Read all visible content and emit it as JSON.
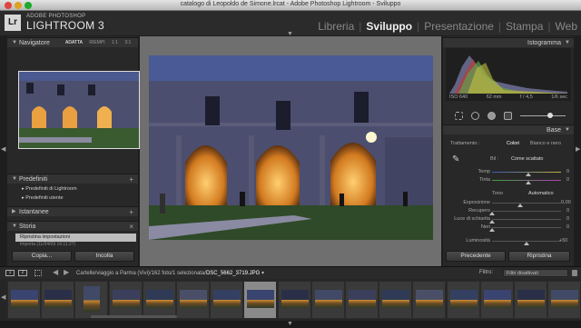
{
  "window": {
    "title": "catalogo di Leopoldo de Simone.lrcat - Adobe Photoshop Lightroom - Sviluppo"
  },
  "brand": {
    "logo": "Lr",
    "small": "ADOBE PHOTOSHOP",
    "big": "LIGHTROOM 3"
  },
  "modules": [
    {
      "label": "Libreria",
      "active": false
    },
    {
      "label": "Sviluppo",
      "active": true
    },
    {
      "label": "Presentazione",
      "active": false
    },
    {
      "label": "Stampa",
      "active": false
    },
    {
      "label": "Web",
      "active": false
    }
  ],
  "left": {
    "navigator": {
      "title": "Navigatore",
      "options": [
        "ADATTA",
        "RIEMPI",
        "1:1",
        "3:1"
      ]
    },
    "presets": {
      "title": "Predefiniti",
      "items": [
        "Predefiniti di Lightroom",
        "Predefiniti utente"
      ]
    },
    "snapshots": {
      "title": "Istantanee"
    },
    "history": {
      "title": "Storia",
      "items": [
        "Ripristina impostazioni",
        "Importa (11/04/09 16:11:27)"
      ]
    },
    "copy_button": "Copia...",
    "paste_button": "Incolla"
  },
  "right": {
    "histogram": {
      "title": "Istogramma",
      "iso": "ISO 640",
      "focal": "62 mm",
      "aperture": "f / 4,5",
      "shutter": "1/6 sec"
    },
    "base": {
      "title": "Base",
      "treatment_label": "Trattamento :",
      "treatment_options": [
        "Colori",
        "Bianco e nero"
      ],
      "wb_label": "Bil :",
      "wb_value": "Come scattato",
      "temp_label": "Temp",
      "temp_value": "0",
      "tint_label": "Tinta",
      "tint_value": "0",
      "tone_label": "Tono",
      "auto_label": "Automatico",
      "exposure_label": "Esposizione",
      "exposure_value": "0,00",
      "recovery_label": "Recupero",
      "recovery_value": "0",
      "fill_label": "Luce di schiarita",
      "fill_value": "0",
      "blacks_label": "Neri",
      "blacks_value": "0",
      "brightness_label": "Luminosità",
      "brightness_value": "+50"
    },
    "previous_button": "Precedente",
    "reset_button": "Ripristina"
  },
  "filmbar": {
    "path": "Cartelle/viaggio a Parma (Vivi)/162 foto/1 selezionata/",
    "file": "DSC_5662_3719.JPG",
    "filter_label": "Filtro:",
    "filter_value": "Filtri disattivati"
  },
  "filmstrip": {
    "count": 17,
    "selected_index": 7
  }
}
